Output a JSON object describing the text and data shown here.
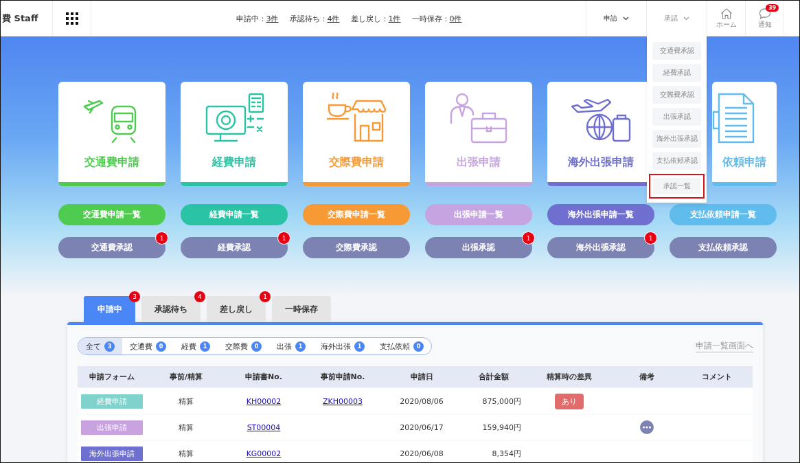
{
  "header": {
    "logo": "費 Staff",
    "status_counts": [
      {
        "label": "申請中：",
        "count": "3件"
      },
      {
        "label": "承認待ち：",
        "count": "4件"
      },
      {
        "label": "差し戻し：",
        "count": "1件"
      },
      {
        "label": "一時保存：",
        "count": "0件"
      }
    ],
    "nav": [
      {
        "label": "申請",
        "open": false
      },
      {
        "label": "承認",
        "open": true
      }
    ],
    "home": "ホーム",
    "notify": {
      "label": "通知",
      "badge": "39"
    }
  },
  "approval_menu": [
    {
      "label": "交通費承認",
      "selected": false
    },
    {
      "label": "経費承認",
      "selected": false
    },
    {
      "label": "交際費承認",
      "selected": false
    },
    {
      "label": "出張承認",
      "selected": false
    },
    {
      "label": "海外出張承認",
      "selected": false
    },
    {
      "label": "支払依頼承認",
      "selected": false
    },
    {
      "label": "承認一覧",
      "selected": true
    }
  ],
  "categories": [
    {
      "kind": "train",
      "title": "交通費申請",
      "color": "#4fcb4f",
      "list_button": "交通費申請一覧",
      "approve_button": "交通費承認",
      "badge": "1"
    },
    {
      "kind": "monitor",
      "title": "経費申請",
      "color": "#2bc3a5",
      "list_button": "経費申請一覧",
      "approve_button": "経費承認",
      "badge": "1"
    },
    {
      "kind": "shop",
      "title": "交際費申請",
      "color": "#f79a35",
      "list_button": "交際費申請一覧",
      "approve_button": "交際費承認"
    },
    {
      "kind": "business",
      "title": "出張申請",
      "color": "#c6a4e2",
      "list_button": "出張申請一覧",
      "approve_button": "出張承認",
      "badge": "1"
    },
    {
      "kind": "travel",
      "title": "海外出張申請",
      "color": "#6e6fcf",
      "list_button": "海外出張申請一覧",
      "approve_button": "海外出張承認",
      "badge": "1"
    },
    {
      "kind": "document",
      "title": "依頼申請",
      "color": "#5fbcec",
      "list_button": "支払依頼申請一覧",
      "approve_button": "支払依頼承認"
    }
  ],
  "tabs": [
    {
      "label": "申請中",
      "badge": "3",
      "selected": true
    },
    {
      "label": "承認待ち",
      "badge": "4",
      "selected": false
    },
    {
      "label": "差し戻し",
      "badge": "1",
      "selected": false
    },
    {
      "label": "一時保存",
      "selected": false
    }
  ],
  "filters": [
    {
      "label": "全て",
      "count": "3",
      "selected": true
    },
    {
      "label": "交通費",
      "count": "0",
      "selected": false
    },
    {
      "label": "経費",
      "count": "1",
      "selected": false
    },
    {
      "label": "交際費",
      "count": "0",
      "selected": false
    },
    {
      "label": "出張",
      "count": "1",
      "selected": false
    },
    {
      "label": "海外出張",
      "count": "1",
      "selected": false
    },
    {
      "label": "支払依頼",
      "count": "0",
      "selected": false
    }
  ],
  "list_link": "申請一覧画面へ",
  "table": {
    "columns": [
      "申請フォーム",
      "事前/精算",
      "申請書No.",
      "事前申請No.",
      "申請日",
      "合計金額",
      "精算時の差異",
      "備考",
      "コメント"
    ],
    "rows": [
      {
        "form": "経費申請",
        "color": "#7fd3cc",
        "timing": "精算",
        "number": "KH00002",
        "prior_number": "ZKH00003",
        "date": "2020/08/06",
        "amount": "875,000円",
        "difference": "あり",
        "has_note": false
      },
      {
        "form": "出張申請",
        "color": "#c8a3e0",
        "timing": "精算",
        "number": "ST00004",
        "date": "2020/06/17",
        "amount": "159,940円",
        "has_note": true
      },
      {
        "form": "海外出張申請",
        "color": "#6e6fcf",
        "timing": "精算",
        "number": "KG00002",
        "date": "2020/06/08",
        "amount": "8,354円",
        "has_note": false
      }
    ]
  }
}
